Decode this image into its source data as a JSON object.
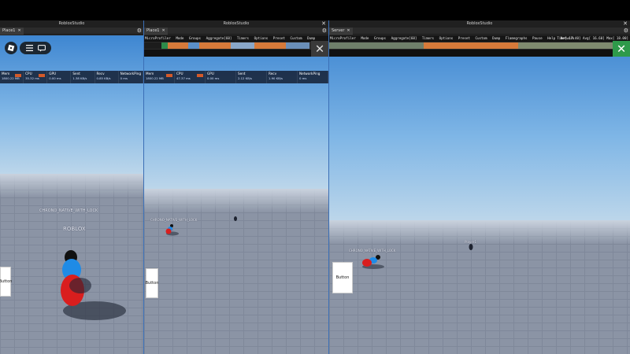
{
  "windows": [
    {
      "title": "RobloxStudio",
      "tab": "Place1",
      "stats": [
        {
          "label": "Mem",
          "value": "1800.22 MB"
        },
        {
          "label": "CPU",
          "value": "35.32 ms"
        },
        {
          "label": "GPU",
          "value": "0.00 ms"
        },
        {
          "label": "Sent",
          "value": "1.38 KB/s"
        },
        {
          "label": "Recv",
          "value": "0.85 KB/s"
        },
        {
          "label": "NetworkPing",
          "value": "0 ms"
        }
      ],
      "nametag": "CHRONO_NATIVE_WITH_LOCK",
      "subtag": "ROBLOX",
      "button_label": "Button"
    },
    {
      "title": "RobloxStudio",
      "tab": "Place1",
      "profiler_menu": [
        "MicroProfiler",
        "Mode",
        "Groups",
        "Aggregate[60]",
        "Timers",
        "Options",
        "Preset",
        "Custom",
        "Dump",
        "Flamegraphs",
        "Pause",
        "Help",
        "Network"
      ],
      "stats": [
        {
          "label": "Mem",
          "value": "1800.22 MB"
        },
        {
          "label": "CPU",
          "value": "47.37 ms"
        },
        {
          "label": "GPU",
          "value": "0.00 ms"
        },
        {
          "label": "Sent",
          "value": "2.12 KB/s"
        },
        {
          "label": "Recv",
          "value": "1.90 KB/s"
        },
        {
          "label": "NetworkPing",
          "value": "0 ms"
        }
      ],
      "nametag": "CHRONO_NATIVE_WITH_LOCK",
      "button_label": "Button"
    },
    {
      "title": "RobloxStudio",
      "tab": "Server",
      "profiler_menu": [
        "MicroProfiler",
        "Mode",
        "Groups",
        "Aggregate[60]",
        "Timers",
        "Options",
        "Preset",
        "Custom",
        "Dump",
        "Flamegraphs",
        "Pause",
        "Help",
        "Network"
      ],
      "profiler_stats": "Time[  17.40] Avg[  16.60] Max[ 18.00]",
      "nametag": "CHRONO_NATIVE_WITH_LOCK",
      "subtag": "Player1",
      "button_label": "Button"
    }
  ],
  "icons": {
    "close": "close-icon",
    "gear": "gear-icon",
    "roblox_logo": "roblox-logo-icon",
    "menu": "hamburger-icon",
    "chat": "chat-icon"
  }
}
